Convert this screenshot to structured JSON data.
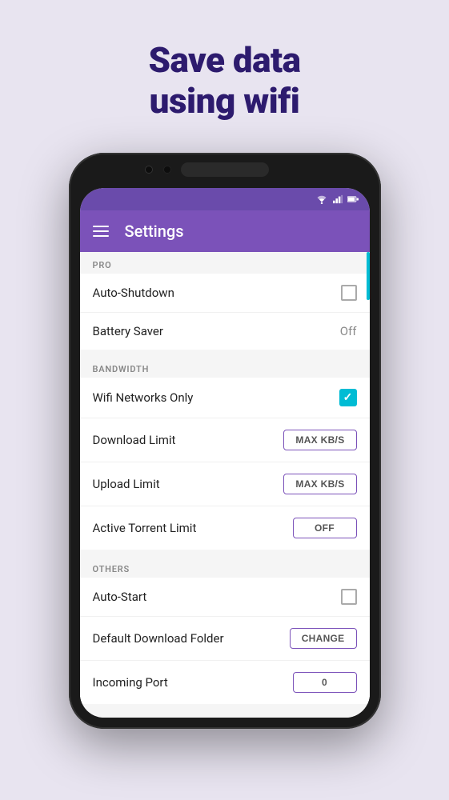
{
  "headline": {
    "line1": "Save data",
    "line2": "using wifi"
  },
  "appBar": {
    "title": "Settings"
  },
  "sections": {
    "pro": {
      "header": "PRO",
      "rows": [
        {
          "label": "Auto-Shutdown",
          "control": "checkbox-empty"
        },
        {
          "label": "Battery Saver",
          "control": "value",
          "value": "Off"
        }
      ]
    },
    "bandwidth": {
      "header": "BANDWIDTH",
      "rows": [
        {
          "label": "Wifi Networks Only",
          "control": "checkbox-checked"
        },
        {
          "label": "Download Limit",
          "control": "button",
          "buttonLabel": "MAX KB/S"
        },
        {
          "label": "Upload Limit",
          "control": "button",
          "buttonLabel": "MAX KB/S"
        },
        {
          "label": "Active Torrent Limit",
          "control": "button",
          "buttonLabel": "OFF"
        }
      ]
    },
    "others": {
      "header": "OTHERS",
      "rows": [
        {
          "label": "Auto-Start",
          "control": "checkbox-empty"
        },
        {
          "label": "Default Download Folder",
          "control": "button",
          "buttonLabel": "CHANGE"
        },
        {
          "label": "Incoming Port",
          "control": "button",
          "buttonLabel": "0"
        }
      ]
    }
  },
  "statusIcons": {
    "wifi": "▼",
    "signal": "▲",
    "battery": "▮"
  }
}
